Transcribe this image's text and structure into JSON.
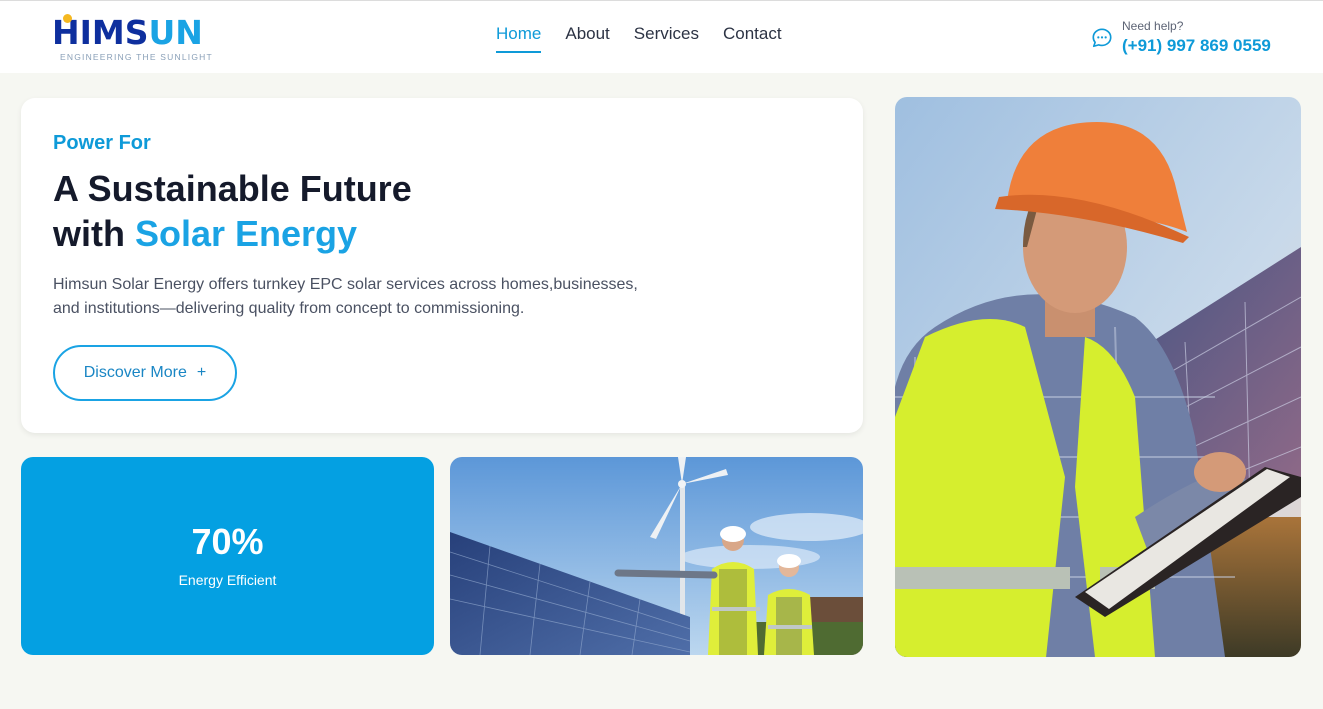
{
  "brand": {
    "logo_part1": "HIMS",
    "logo_part2": "UN",
    "tagline": "ENGINEERING THE SUNLIGHT"
  },
  "nav": {
    "items": [
      {
        "label": "Home",
        "active": true
      },
      {
        "label": "About",
        "active": false
      },
      {
        "label": "Services",
        "active": false
      },
      {
        "label": "Contact",
        "active": false
      }
    ]
  },
  "help": {
    "label": "Need help?",
    "phone": "(+91) 997 869 0559",
    "icon": "chat-bubble-icon"
  },
  "hero": {
    "eyebrow": "Power For",
    "headline_line1": "A Sustainable Future",
    "headline_line2_prefix": "with ",
    "headline_highlight": "Solar Energy",
    "description": "Himsun Solar Energy offers turnkey EPC solar services across homes,businesses, and institutions—delivering quality from concept to commissioning.",
    "cta_label": "Discover More",
    "cta_icon": "+"
  },
  "stat": {
    "value": "70%",
    "label": "Energy Efficient"
  },
  "colors": {
    "accent": "#1aa3e4",
    "stat_bg": "#04a0e2",
    "brand_dark": "#0e2f9e",
    "page_bg": "#f6f7f2"
  }
}
